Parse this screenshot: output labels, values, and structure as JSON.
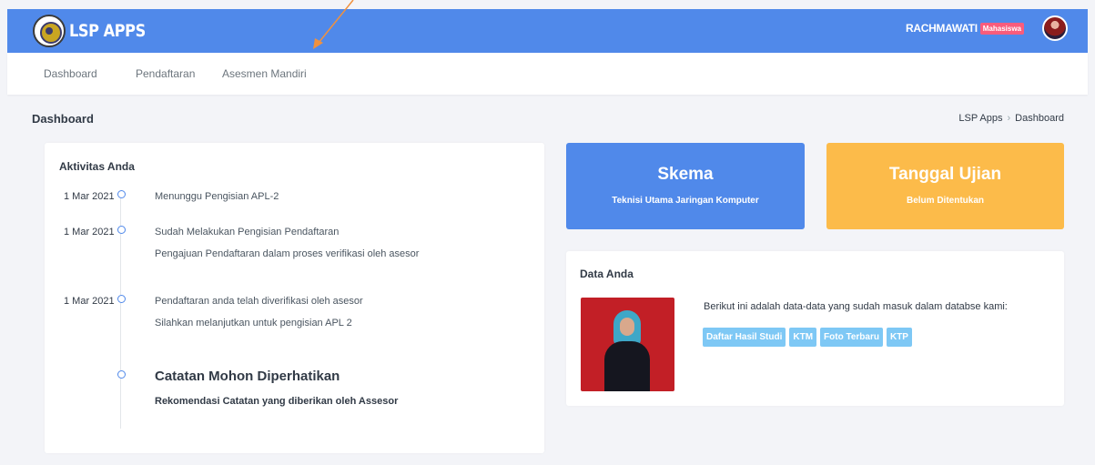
{
  "header": {
    "app_title": "LSP APPS",
    "user_name": "RACHMAWATI",
    "user_role": "Mahasiswa"
  },
  "nav": {
    "items": [
      {
        "label": "Dashboard"
      },
      {
        "label": "Pendaftaran"
      },
      {
        "label": "Asesmen Mandiri"
      }
    ]
  },
  "page": {
    "title": "Dashboard",
    "breadcrumb": [
      "LSP Apps",
      "Dashboard"
    ]
  },
  "activity": {
    "title": "Aktivitas Anda",
    "items": [
      {
        "date": "1 Mar 2021",
        "text": "Menunggu Pengisian APL-2",
        "sub": ""
      },
      {
        "date": "1 Mar 2021",
        "text": "Sudah Melakukan Pengisian Pendaftaran",
        "sub": "Pengajuan Pendaftaran dalam proses verifikasi oleh asesor"
      },
      {
        "date": "1 Mar 2021",
        "text": "Pendaftaran anda telah diverifikasi oleh asesor",
        "sub": "Silahkan melanjutkan untuk pengisian APL 2"
      }
    ],
    "note_title": "Catatan Mohon Diperhatikan",
    "note_sub": "Rekomendasi Catatan yang diberikan oleh Assesor"
  },
  "skema": {
    "title": "Skema",
    "value": "Teknisi Utama Jaringan Komputer"
  },
  "tanggal": {
    "title": "Tanggal Ujian",
    "value": "Belum Ditentukan"
  },
  "data_anda": {
    "title": "Data Anda",
    "text": "Berikut ini adalah data-data yang sudah masuk dalam databse kami:",
    "tags": [
      "Daftar Hasil Studi",
      "KTM",
      "Foto Terbaru",
      "KTP"
    ]
  },
  "colors": {
    "primary": "#5089ea",
    "warning": "#fcbb4a",
    "info": "#7ec8f5",
    "danger": "#fa5c7c",
    "annotation_arrow": "#f0913e"
  }
}
